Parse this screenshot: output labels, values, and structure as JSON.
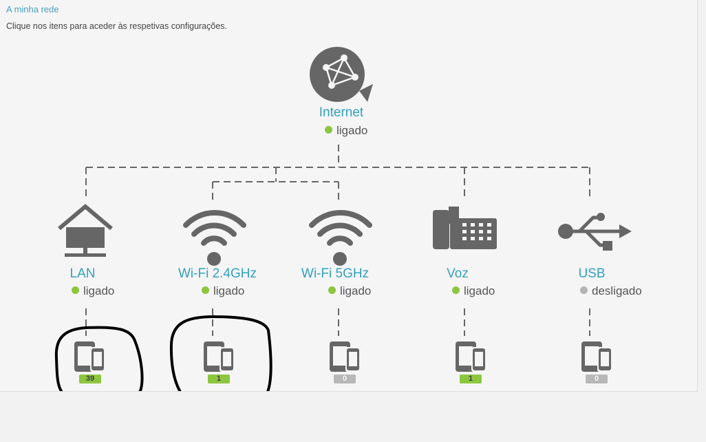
{
  "header": {
    "breadcrumb": "A minha rede",
    "hint": "Clique nos itens para aceder às respetivas configurações."
  },
  "colors": {
    "accent": "#33a0bd",
    "icon": "#666666",
    "status_on": "#8cc63f",
    "status_off": "#b4b4b4"
  },
  "internet": {
    "label": "Internet",
    "status": "ligado",
    "icon": "globe-network-icon"
  },
  "nodes": [
    {
      "id": "lan",
      "label": "LAN",
      "status": "ligado",
      "icon": "house-network-icon",
      "devices": "39",
      "devices_active": true
    },
    {
      "id": "wifi24",
      "label": "Wi-Fi 2.4GHz",
      "status": "ligado",
      "icon": "wifi-icon",
      "devices": "1",
      "devices_active": true
    },
    {
      "id": "wifi5",
      "label": "Wi-Fi 5GHz",
      "status": "ligado",
      "icon": "wifi-icon",
      "devices": "0",
      "devices_active": false
    },
    {
      "id": "voz",
      "label": "Voz",
      "status": "ligado",
      "icon": "desk-phone-icon",
      "devices": "1",
      "devices_active": true
    },
    {
      "id": "usb",
      "label": "USB",
      "status": "desligado",
      "icon": "usb-icon",
      "devices": "0",
      "devices_active": false
    }
  ]
}
